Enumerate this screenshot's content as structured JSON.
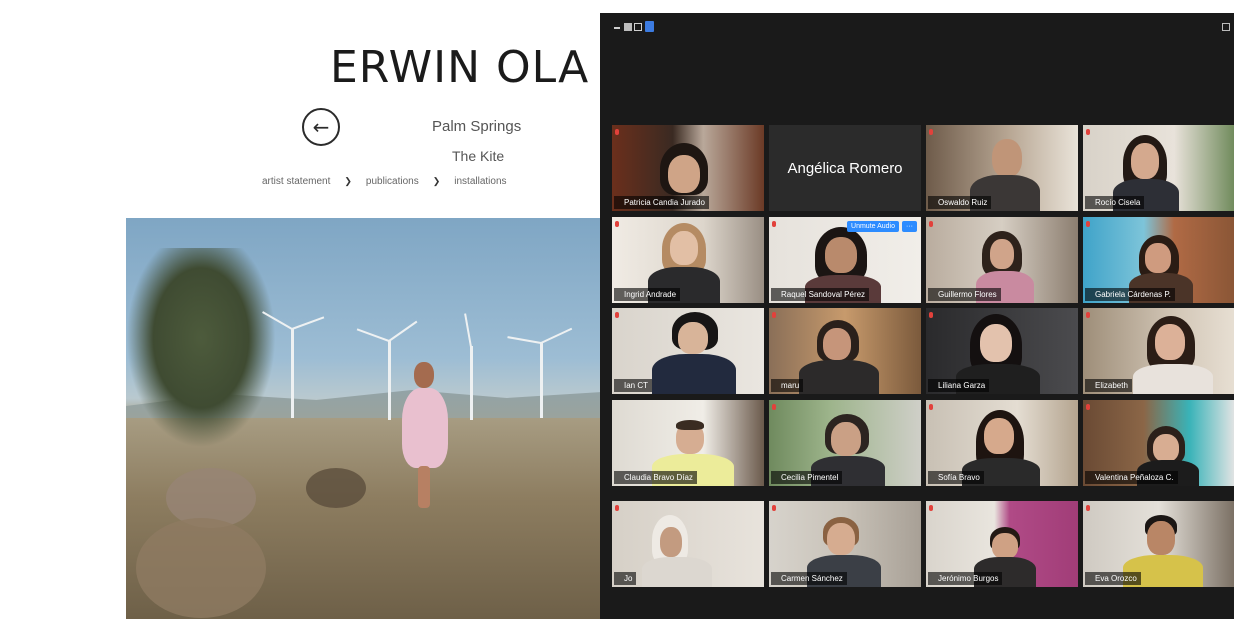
{
  "website": {
    "title": "ERWIN OLA",
    "back_icon": "arrow-left-circle-icon",
    "back_glyph": "←",
    "subtitle_place": "Palm Springs",
    "subtitle_work": "The Kite",
    "nav": [
      "artist statement",
      "publications",
      "installations"
    ],
    "nav_separator": "❯"
  },
  "zoom": {
    "toolbar_icons": [
      "minimize-icon",
      "speaker-view-icon",
      "gallery-view-icon",
      "fullscreen-icon",
      "options-icon"
    ],
    "colors": {
      "window_bg": "#1a1a1a",
      "active_speaker": "#c9d85a",
      "muted": "#e2413b",
      "accent": "#2d8cff"
    },
    "participants": [
      {
        "name": "Patricia Candia Jurado",
        "muted": true
      },
      {
        "name": "Angélica Romero",
        "video": false
      },
      {
        "name": "Oswaldo Ruiz",
        "muted": true
      },
      {
        "name": "Rocío Cisela",
        "muted": true
      },
      {
        "name": "Ingrid Andrade",
        "muted": true
      },
      {
        "name": "Raquel Sandoval Pérez",
        "muted": true,
        "hover": true
      },
      {
        "name": "Guillermo Flores",
        "muted": true
      },
      {
        "name": "Gabriela Cárdenas P.",
        "muted": true
      },
      {
        "name": "Ian CT",
        "muted": true
      },
      {
        "name": "maru",
        "muted": true
      },
      {
        "name": "Liliana Garza",
        "muted": true
      },
      {
        "name": "Elizabeth",
        "muted": true
      },
      {
        "name": "Claudia Bravo Díaz",
        "active": true
      },
      {
        "name": "Cecilia Pimentel",
        "muted": true
      },
      {
        "name": "Sofía Bravo",
        "muted": true
      },
      {
        "name": "Valentina Peñaloza C.",
        "muted": true
      },
      {
        "name": "Jo",
        "muted": true
      },
      {
        "name": "Carmen Sánchez",
        "muted": true
      },
      {
        "name": "Jerónimo Burgos",
        "muted": true
      },
      {
        "name": "Eva Orozco",
        "muted": true
      }
    ],
    "hover_actions": {
      "primary": "Unmute Audio",
      "more": "···"
    }
  }
}
